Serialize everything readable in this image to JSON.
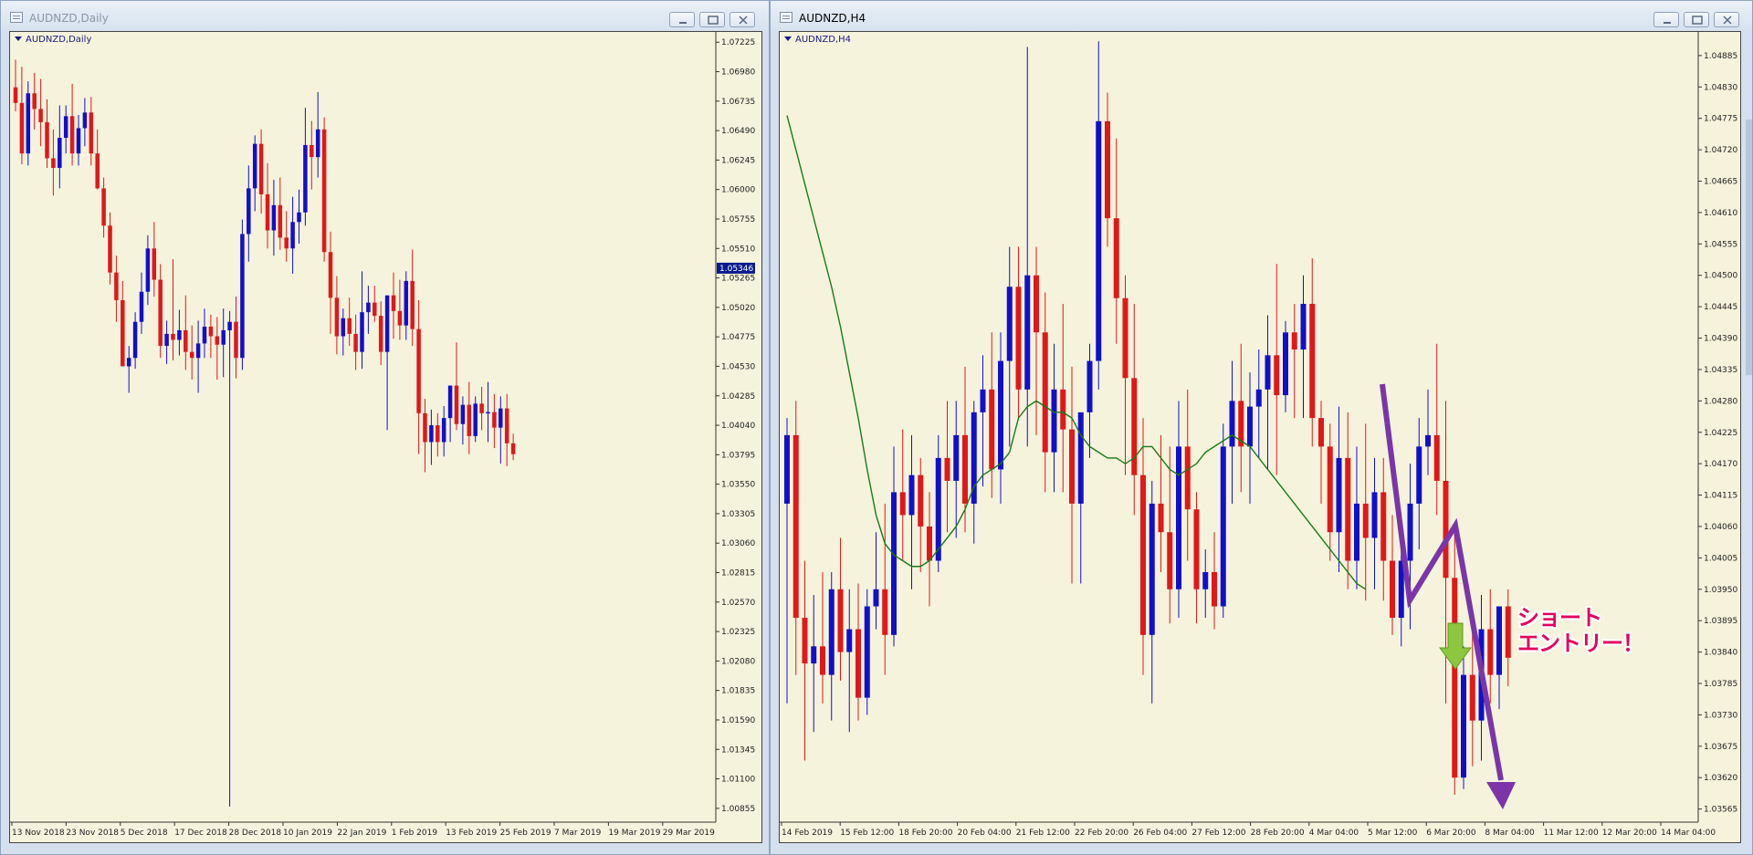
{
  "windows": {
    "left": {
      "title": "AUDNZD,Daily",
      "chart_label": "AUDNZD,Daily",
      "active": false
    },
    "right": {
      "title": "AUDNZD,H4",
      "chart_label": "AUDNZD,H4",
      "active": true
    }
  },
  "colors": {
    "bull": "#1010cc",
    "bear": "#e01818",
    "ma": "#1a7a1a",
    "annotation_arrow": "#7b35a8",
    "annotation_text": "#e5005a",
    "down_arrow": "#8dc63f",
    "background": "#f5f3dc"
  },
  "icons": [
    "chart-window-icon",
    "minimize-icon",
    "maximize-icon",
    "close-icon",
    "chart-label-triangle-icon"
  ],
  "annotation": {
    "text_line1": "ショート",
    "text_line2": "エントリー！"
  },
  "chart_data": [
    {
      "type": "candlestick",
      "symbol": "AUDNZD",
      "timeframe": "Daily",
      "current_price": "1.05346",
      "y_ticks": [
        "1.07225",
        "1.06980",
        "1.06735",
        "1.06490",
        "1.06245",
        "1.06000",
        "1.05755",
        "1.05510",
        "1.05265",
        "1.05020",
        "1.04775",
        "1.04530",
        "1.04285",
        "1.04040",
        "1.03795",
        "1.03550",
        "1.03305",
        "1.03060",
        "1.02815",
        "1.02570",
        "1.02325",
        "1.02080",
        "1.01835",
        "1.01590",
        "1.01345",
        "1.01100",
        "1.00855"
      ],
      "x_ticks": [
        "13 Nov 2018",
        "23 Nov 2018",
        "5 Dec 2018",
        "17 Dec 2018",
        "28 Dec 2018",
        "10 Jan 2019",
        "22 Jan 2019",
        "1 Feb 2019",
        "13 Feb 2019",
        "25 Feb 2019",
        "7 Mar 2019",
        "19 Mar 2019",
        "29 Mar 2019"
      ],
      "ylim": [
        1.0074,
        1.0728
      ],
      "candles": [
        [
          1.0685,
          1.0708,
          1.0665,
          1.0672
        ],
        [
          1.0672,
          1.0702,
          1.0621,
          1.063
        ],
        [
          1.063,
          1.069,
          1.062,
          1.068
        ],
        [
          1.068,
          1.0697,
          1.065,
          1.0667
        ],
        [
          1.0667,
          1.0692,
          1.0636,
          1.0656
        ],
        [
          1.0656,
          1.0675,
          1.0618,
          1.0626
        ],
        [
          1.0626,
          1.065,
          1.0595,
          1.0618
        ],
        [
          1.0618,
          1.067,
          1.0601,
          1.0643
        ],
        [
          1.0643,
          1.067,
          1.063,
          1.0661
        ],
        [
          1.0661,
          1.0688,
          1.062,
          1.063
        ],
        [
          1.063,
          1.0662,
          1.062,
          1.0651
        ],
        [
          1.0651,
          1.0676,
          1.0636,
          1.0664
        ],
        [
          1.0664,
          1.0677,
          1.062,
          1.063
        ],
        [
          1.063,
          1.065,
          1.06,
          1.0601
        ],
        [
          1.0601,
          1.061,
          1.056,
          1.057
        ],
        [
          1.057,
          1.0581,
          1.0521,
          1.0531
        ],
        [
          1.0531,
          1.0545,
          1.049,
          1.0508
        ],
        [
          1.0508,
          1.0524,
          1.0471,
          1.0453
        ],
        [
          1.0453,
          1.047,
          1.0431,
          1.046
        ],
        [
          1.046,
          1.0498,
          1.0451,
          1.049
        ],
        [
          1.049,
          1.0531,
          1.048,
          1.0515
        ],
        [
          1.0515,
          1.0562,
          1.0504,
          1.0551
        ],
        [
          1.0551,
          1.0573,
          1.0511,
          1.0525
        ],
        [
          1.0525,
          1.0538,
          1.046,
          1.047
        ],
        [
          1.047,
          1.0491,
          1.0455,
          1.048
        ],
        [
          1.048,
          1.0542,
          1.0458,
          1.0475
        ],
        [
          1.0475,
          1.05,
          1.0462,
          1.0483
        ],
        [
          1.0483,
          1.0512,
          1.045,
          1.0465
        ],
        [
          1.0465,
          1.0487,
          1.0442,
          1.046
        ],
        [
          1.046,
          1.0491,
          1.0431,
          1.0472
        ],
        [
          1.0472,
          1.0501,
          1.046,
          1.0486
        ],
        [
          1.0486,
          1.0496,
          1.046,
          1.0478
        ],
        [
          1.0478,
          1.0494,
          1.0442,
          1.0471
        ],
        [
          1.0471,
          1.0501,
          1.0444,
          1.0483
        ],
        [
          1.0483,
          1.0499,
          1.0087,
          1.049
        ],
        [
          1.049,
          1.0511,
          1.0443,
          1.046
        ],
        [
          1.046,
          1.0575,
          1.045,
          1.0563
        ],
        [
          1.0563,
          1.062,
          1.054,
          1.0601
        ],
        [
          1.0601,
          1.0645,
          1.0582,
          1.0638
        ],
        [
          1.0638,
          1.065,
          1.058,
          1.0596
        ],
        [
          1.0596,
          1.0622,
          1.0551,
          1.0566
        ],
        [
          1.0566,
          1.0608,
          1.0545,
          1.0587
        ],
        [
          1.0587,
          1.061,
          1.055,
          1.056
        ],
        [
          1.056,
          1.0582,
          1.054,
          1.0551
        ],
        [
          1.0551,
          1.0594,
          1.053,
          1.0573
        ],
        [
          1.0573,
          1.06,
          1.0555,
          1.0581
        ],
        [
          1.0581,
          1.0668,
          1.057,
          1.0637
        ],
        [
          1.0637,
          1.0657,
          1.06,
          1.0627
        ],
        [
          1.0627,
          1.0681,
          1.061,
          1.065
        ],
        [
          1.065,
          1.066,
          1.054,
          1.0548
        ],
        [
          1.0548,
          1.0565,
          1.048,
          1.051
        ],
        [
          1.051,
          1.0528,
          1.0463,
          1.0478
        ],
        [
          1.0478,
          1.0501,
          1.0462,
          1.0493
        ],
        [
          1.0493,
          1.051,
          1.047,
          1.048
        ],
        [
          1.048,
          1.0496,
          1.045,
          1.0465
        ],
        [
          1.0465,
          1.0532,
          1.0451,
          1.0498
        ],
        [
          1.0498,
          1.052,
          1.048,
          1.0506
        ],
        [
          1.0506,
          1.052,
          1.049,
          1.0495
        ],
        [
          1.0495,
          1.0507,
          1.0454,
          1.0465
        ],
        [
          1.0465,
          1.0506,
          1.04,
          1.0512
        ],
        [
          1.0512,
          1.0531,
          1.0476,
          1.0499
        ],
        [
          1.0499,
          1.0525,
          1.0475,
          1.0487
        ],
        [
          1.0487,
          1.0532,
          1.0475,
          1.0524
        ],
        [
          1.0524,
          1.055,
          1.047,
          1.0484
        ],
        [
          1.0484,
          1.0508,
          1.038,
          1.0414
        ],
        [
          1.0414,
          1.0426,
          1.0365,
          1.039
        ],
        [
          1.039,
          1.0417,
          1.0371,
          1.0404
        ],
        [
          1.0404,
          1.0414,
          1.0378,
          1.039
        ],
        [
          1.039,
          1.042,
          1.0378,
          1.041
        ],
        [
          1.041,
          1.0431,
          1.039,
          1.0437
        ],
        [
          1.0437,
          1.0473,
          1.04,
          1.0405
        ],
        [
          1.0405,
          1.0428,
          1.0388,
          1.0421
        ],
        [
          1.0421,
          1.044,
          1.038,
          1.0395
        ],
        [
          1.0395,
          1.0428,
          1.039,
          1.0422
        ],
        [
          1.0422,
          1.0436,
          1.04,
          1.0414
        ],
        [
          1.0414,
          1.044,
          1.039,
          1.0415
        ],
        [
          1.0415,
          1.043,
          1.0385,
          1.0402
        ],
        [
          1.0402,
          1.0428,
          1.0372,
          1.0418
        ],
        [
          1.0418,
          1.043,
          1.037,
          1.0389
        ],
        [
          1.0389,
          1.0397,
          1.0375,
          1.038
        ]
      ]
    },
    {
      "type": "candlestick",
      "symbol": "AUDNZD",
      "timeframe": "H4",
      "indicator": "moving average",
      "y_ticks": [
        "1.04885",
        "1.04830",
        "1.04775",
        "1.04720",
        "1.04665",
        "1.04610",
        "1.04555",
        "1.04500",
        "1.04445",
        "1.04390",
        "1.04335",
        "1.04280",
        "1.04225",
        "1.04170",
        "1.04115",
        "1.04060",
        "1.04005",
        "1.03950",
        "1.03895",
        "1.03840",
        "1.03785",
        "1.03730",
        "1.03675",
        "1.03620",
        "1.03565"
      ],
      "x_ticks": [
        "14 Feb 2019",
        "15 Feb 12:00",
        "18 Feb 20:00",
        "20 Feb 04:00",
        "21 Feb 12:00",
        "22 Feb 20:00",
        "26 Feb 04:00",
        "27 Feb 12:00",
        "28 Feb 20:00",
        "4 Mar 04:00",
        "5 Mar 12:00",
        "6 Mar 20:00",
        "8 Mar 04:00",
        "11 Mar 12:00",
        "12 Mar 20:00",
        "14 Mar 04:00"
      ],
      "ylim": [
        1.03542,
        1.0492
      ],
      "candles": [
        [
          1.041,
          1.0425,
          1.0375,
          1.0422
        ],
        [
          1.0422,
          1.0428,
          1.038,
          1.039
        ],
        [
          1.039,
          1.04,
          1.0365,
          1.0382
        ],
        [
          1.0382,
          1.0394,
          1.037,
          1.0385
        ],
        [
          1.0385,
          1.0398,
          1.0375,
          1.038
        ],
        [
          1.038,
          1.0398,
          1.0372,
          1.0395
        ],
        [
          1.0395,
          1.0404,
          1.0379,
          1.0384
        ],
        [
          1.0384,
          1.0395,
          1.037,
          1.0388
        ],
        [
          1.0388,
          1.0396,
          1.0372,
          1.0376
        ],
        [
          1.0376,
          1.0395,
          1.0373,
          1.0392
        ],
        [
          1.0392,
          1.0405,
          1.0388,
          1.0395
        ],
        [
          1.0395,
          1.041,
          1.038,
          1.0387
        ],
        [
          1.0387,
          1.042,
          1.0385,
          1.0412
        ],
        [
          1.0412,
          1.0423,
          1.04,
          1.0408
        ],
        [
          1.0408,
          1.0422,
          1.0395,
          1.0415
        ],
        [
          1.0415,
          1.0418,
          1.0398,
          1.0406
        ],
        [
          1.0406,
          1.0412,
          1.0392,
          1.04
        ],
        [
          1.04,
          1.0422,
          1.0398,
          1.0418
        ],
        [
          1.0418,
          1.0428,
          1.0405,
          1.0414
        ],
        [
          1.0414,
          1.0428,
          1.0404,
          1.0422
        ],
        [
          1.0422,
          1.0434,
          1.0405,
          1.041
        ],
        [
          1.041,
          1.0428,
          1.0403,
          1.0426
        ],
        [
          1.0426,
          1.0436,
          1.0413,
          1.043
        ],
        [
          1.043,
          1.044,
          1.0411,
          1.0416
        ],
        [
          1.0416,
          1.044,
          1.041,
          1.0435
        ],
        [
          1.0435,
          1.0455,
          1.042,
          1.0448
        ],
        [
          1.0448,
          1.0455,
          1.0425,
          1.043
        ],
        [
          1.043,
          1.049,
          1.042,
          1.045
        ],
        [
          1.045,
          1.0455,
          1.0422,
          1.044
        ],
        [
          1.044,
          1.0447,
          1.0412,
          1.0419
        ],
        [
          1.0419,
          1.0438,
          1.0412,
          1.043
        ],
        [
          1.043,
          1.0445,
          1.0412,
          1.0423
        ],
        [
          1.0423,
          1.0434,
          1.0396,
          1.041
        ],
        [
          1.041,
          1.0425,
          1.0396,
          1.0426
        ],
        [
          1.0426,
          1.0438,
          1.0418,
          1.0435
        ],
        [
          1.0435,
          1.0491,
          1.043,
          1.0477
        ],
        [
          1.0477,
          1.0482,
          1.0455,
          1.046
        ],
        [
          1.046,
          1.0474,
          1.0438,
          1.0446
        ],
        [
          1.0446,
          1.045,
          1.0415,
          1.0432
        ],
        [
          1.0432,
          1.0445,
          1.0408,
          1.0415
        ],
        [
          1.0415,
          1.0425,
          1.038,
          1.0387
        ],
        [
          1.0387,
          1.0414,
          1.0375,
          1.041
        ],
        [
          1.041,
          1.0422,
          1.0398,
          1.0405
        ],
        [
          1.0405,
          1.042,
          1.0389,
          1.0395
        ],
        [
          1.0395,
          1.0428,
          1.039,
          1.042
        ],
        [
          1.042,
          1.043,
          1.04,
          1.0409
        ],
        [
          1.0409,
          1.0412,
          1.0389,
          1.0395
        ],
        [
          1.0395,
          1.0402,
          1.039,
          1.0398
        ],
        [
          1.0398,
          1.0405,
          1.0388,
          1.0392
        ],
        [
          1.0392,
          1.0424,
          1.039,
          1.042
        ],
        [
          1.042,
          1.0435,
          1.041,
          1.0428
        ],
        [
          1.0428,
          1.0438,
          1.0412,
          1.042
        ],
        [
          1.042,
          1.0433,
          1.041,
          1.0427
        ],
        [
          1.0427,
          1.0437,
          1.0418,
          1.043
        ],
        [
          1.043,
          1.0443,
          1.0416,
          1.0436
        ],
        [
          1.0436,
          1.0452,
          1.0415,
          1.0429
        ],
        [
          1.0429,
          1.0442,
          1.0426,
          1.044
        ],
        [
          1.044,
          1.0445,
          1.0425,
          1.0437
        ],
        [
          1.0437,
          1.045,
          1.0425,
          1.0445
        ],
        [
          1.0445,
          1.0453,
          1.042,
          1.0425
        ],
        [
          1.0425,
          1.0428,
          1.041,
          1.042
        ],
        [
          1.042,
          1.0424,
          1.04,
          1.0405
        ],
        [
          1.0405,
          1.0427,
          1.0398,
          1.0418
        ],
        [
          1.0418,
          1.0426,
          1.0395,
          1.04
        ],
        [
          1.04,
          1.042,
          1.0395,
          1.041
        ],
        [
          1.041,
          1.0424,
          1.0393,
          1.0404
        ],
        [
          1.0404,
          1.0418,
          1.0395,
          1.0412
        ],
        [
          1.0412,
          1.0418,
          1.0393,
          1.04
        ],
        [
          1.04,
          1.0408,
          1.0387,
          1.039
        ],
        [
          1.039,
          1.0405,
          1.0385,
          1.04
        ],
        [
          1.04,
          1.0417,
          1.0388,
          1.041
        ],
        [
          1.041,
          1.0425,
          1.0402,
          1.042
        ],
        [
          1.042,
          1.043,
          1.0415,
          1.0422
        ],
        [
          1.0422,
          1.0438,
          1.0408,
          1.0414
        ],
        [
          1.0414,
          1.0428,
          1.0375,
          1.0397
        ],
        [
          1.0397,
          1.0405,
          1.0359,
          1.0362
        ],
        [
          1.0362,
          1.0385,
          1.036,
          1.038
        ],
        [
          1.038,
          1.0388,
          1.0364,
          1.0372
        ],
        [
          1.0372,
          1.0394,
          1.0365,
          1.0388
        ],
        [
          1.0388,
          1.0395,
          1.0375,
          1.038
        ],
        [
          1.038,
          1.0392,
          1.0374,
          1.0392
        ],
        [
          1.0392,
          1.0395,
          1.0378,
          1.0383
        ]
      ],
      "ma": [
        1.0478,
        1.0472,
        1.0466,
        1.046,
        1.0454,
        1.0448,
        1.0441,
        1.0433,
        1.0425,
        1.0416,
        1.0408,
        1.0403,
        1.0401,
        1.04,
        1.0399,
        1.0399,
        1.04,
        1.0402,
        1.0404,
        1.0406,
        1.0409,
        1.0413,
        1.0415,
        1.0416,
        1.0417,
        1.0419,
        1.0425,
        1.0427,
        1.0428,
        1.0427,
        1.0426,
        1.0426,
        1.0425,
        1.0422,
        1.042,
        1.0419,
        1.0418,
        1.0418,
        1.0417,
        1.0418,
        1.042,
        1.042,
        1.0418,
        1.0416,
        1.0415,
        1.0416,
        1.0417,
        1.0419,
        1.042,
        1.0421,
        1.0422,
        1.0421,
        1.042,
        1.0418,
        1.0416,
        1.0414,
        1.0412,
        1.041,
        1.0408,
        1.0406,
        1.0404,
        1.0402,
        1.04,
        1.0398,
        1.0396,
        1.0395
      ]
    }
  ]
}
